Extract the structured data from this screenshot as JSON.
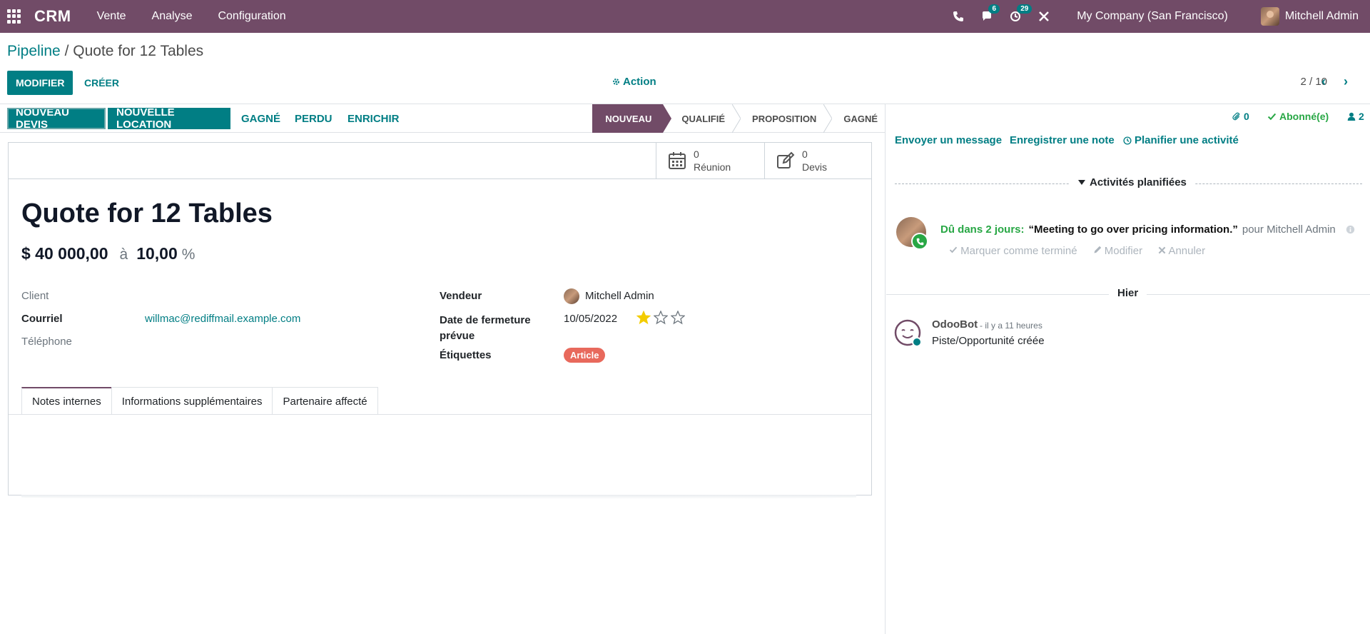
{
  "navbar": {
    "brand": "CRM",
    "menu": [
      "Vente",
      "Analyse",
      "Configuration"
    ],
    "messages_count": "6",
    "activities_count": "29",
    "company": "My Company (San Francisco)",
    "user": "Mitchell Admin"
  },
  "breadcrumb": {
    "parent": "Pipeline",
    "separator": " / ",
    "current": "Quote for 12 Tables"
  },
  "toolbar": {
    "edit_label": "MODIFIER",
    "create_label": "CRÉER",
    "action_label": "Action",
    "pager": "2 / 10"
  },
  "statusbar": {
    "buttons": [
      "NOUVEAU DEVIS",
      "NOUVELLE LOCATION",
      "GAGNÉ",
      "PERDU",
      "ENRICHIR"
    ],
    "stages": [
      "NOUVEAU",
      "QUALIFIÉ",
      "PROPOSITION",
      "GAGNÉ"
    ],
    "active_stage": "NOUVEAU"
  },
  "smart_buttons": [
    {
      "value": "0",
      "label": "Réunion",
      "icon": "calendar-icon"
    },
    {
      "value": "0",
      "label": "Devis",
      "icon": "edit-icon"
    }
  ],
  "form": {
    "title": "Quote for 12 Tables",
    "expected_revenue": "$ 40 000,00",
    "at": "à",
    "probability": "10,00",
    "percent": "%",
    "fields": {
      "client_label": "Client",
      "email_label": "Courriel",
      "email_value": "willmac@rediffmail.example.com",
      "phone_label": "Téléphone",
      "salesperson_label": "Vendeur",
      "salesperson_value": "Mitchell Admin",
      "close_date_label_1": "Date de fermeture",
      "close_date_label_2": "prévue",
      "close_date_value": "10/05/2022",
      "priority_stars": 1,
      "priority_max": 3,
      "tags_label": "Étiquettes",
      "tag": "Article"
    },
    "tabs": [
      "Notes internes",
      "Informations supplémentaires",
      "Partenaire affecté"
    ],
    "active_tab": "Notes internes"
  },
  "chatter": {
    "attachments": "0",
    "follow_label": "Abonné(e)",
    "followers": "2",
    "send_message": "Envoyer un message",
    "log_note": "Enregistrer une note",
    "schedule_activity": "Planifier une activité",
    "planned_title": "Activités planifiées",
    "activity": {
      "due": "Dû dans 2 jours:",
      "summary": "“Meeting to go over pricing information.”",
      "for": "pour Mitchell Admin",
      "actions": [
        "Marquer comme terminé",
        "Modifier",
        "Annuler"
      ]
    },
    "date_separator": "Hier",
    "message": {
      "author": "OdooBot",
      "time": "- il y a 11 heures",
      "body": "Piste/Opportunité créée"
    }
  },
  "colors": {
    "navbar": "#714b67",
    "primary": "#017e84",
    "success": "#28a745",
    "tag": "#e8695c"
  }
}
